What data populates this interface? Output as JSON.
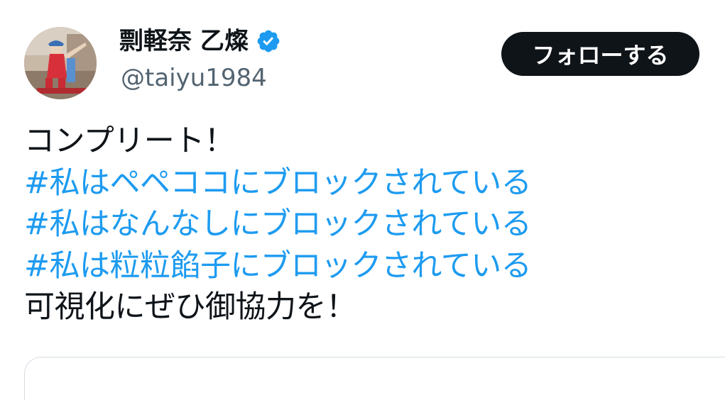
{
  "author": {
    "display_name": "剽軽奈 乙燦",
    "handle": "@taiyu1984",
    "verified": true,
    "avatar_icon": "profile-photo"
  },
  "actions": {
    "follow_label": "フォローする"
  },
  "tweet": {
    "lines": [
      {
        "text": "コンプリート！",
        "type": "text"
      },
      {
        "text": "#私はペペココにブロックされている",
        "type": "hashtag"
      },
      {
        "text": "#私はなんなしにブロックされている",
        "type": "hashtag"
      },
      {
        "text": "#私は粒粒餡子にブロックされている",
        "type": "hashtag"
      },
      {
        "text": "可視化にぜひ御協力を！",
        "type": "text"
      }
    ]
  },
  "colors": {
    "text": "#0f1419",
    "secondary": "#536471",
    "hashtag": "#1d9bf0",
    "verified_badge": "#1d9bf0",
    "button_bg": "#0f1419",
    "button_text": "#ffffff"
  }
}
